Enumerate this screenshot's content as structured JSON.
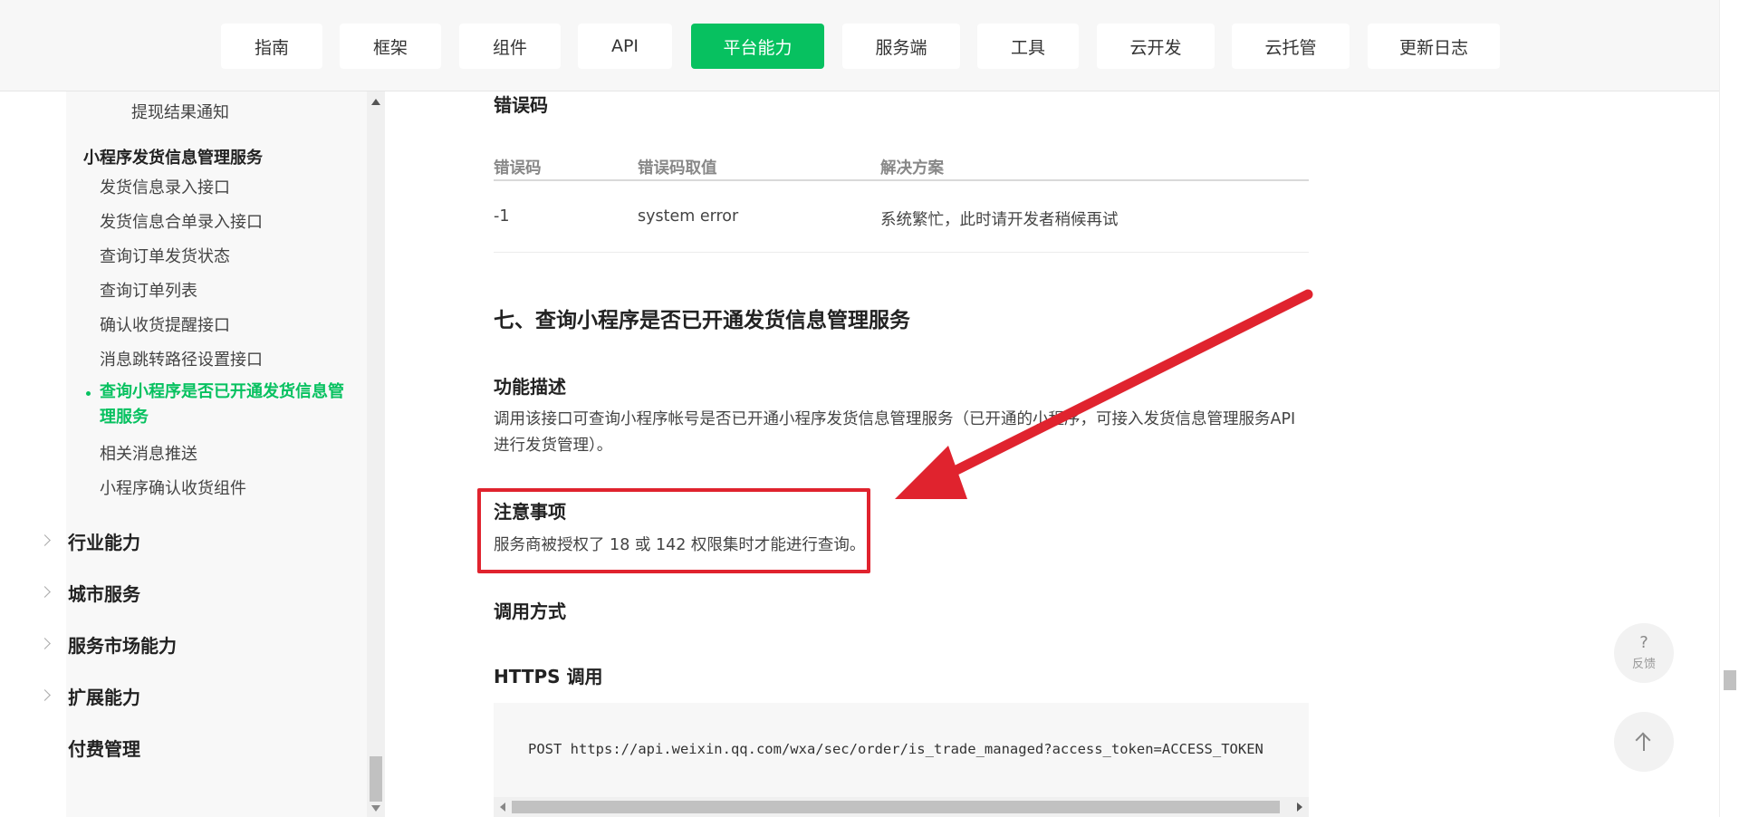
{
  "nav": {
    "items": [
      "指南",
      "框架",
      "组件",
      "API",
      "平台能力",
      "服务端",
      "工具",
      "云开发",
      "云托管",
      "更新日志"
    ],
    "active": "平台能力"
  },
  "sidebar": {
    "items": [
      "提现结果通知",
      "小程序发货信息管理服务",
      "发货信息录入接口",
      "发货信息合单录入接口",
      "查询订单发货状态",
      "查询订单列表",
      "确认收货提醒接口",
      "消息跳转路径设置接口",
      "查询小程序是否已开通发货信息管理服务",
      "相关消息推送",
      "小程序确认收货组件"
    ],
    "sections": [
      "行业能力",
      "城市服务",
      "服务市场能力",
      "扩展能力",
      "付费管理"
    ]
  },
  "content": {
    "error_heading": "错误码",
    "table_headers": [
      "错误码",
      "错误码取值",
      "解决方案"
    ],
    "table_row": [
      "-1",
      "system error",
      "系统繁忙，此时请开发者稍候再试"
    ],
    "section_title": "七、查询小程序是否已开通发货信息管理服务",
    "desc_heading": "功能描述",
    "desc_line1": "调用该接口可查询小程序帐号是否已开通小程序发货信息管理服务（已开通的小程序，可接入发货信息管理服务API",
    "desc_line2": "进行发货管理）。",
    "notice_heading": "注意事项",
    "notice_text": "服务商被授权了 18 或 142 权限集时才能进行查询。",
    "call_heading": "调用方式",
    "https_heading": "HTTPS 调用",
    "code": "POST https://api.weixin.qq.com/wxa/sec/order/is_trade_managed?access_token=ACCESS_TOKEN"
  },
  "float": {
    "feedback_symbol": "?",
    "feedback_label": "反馈",
    "top_icon": "arrow-up-icon"
  },
  "colors": {
    "accent": "#07c160",
    "annotation": "#e0232e"
  }
}
